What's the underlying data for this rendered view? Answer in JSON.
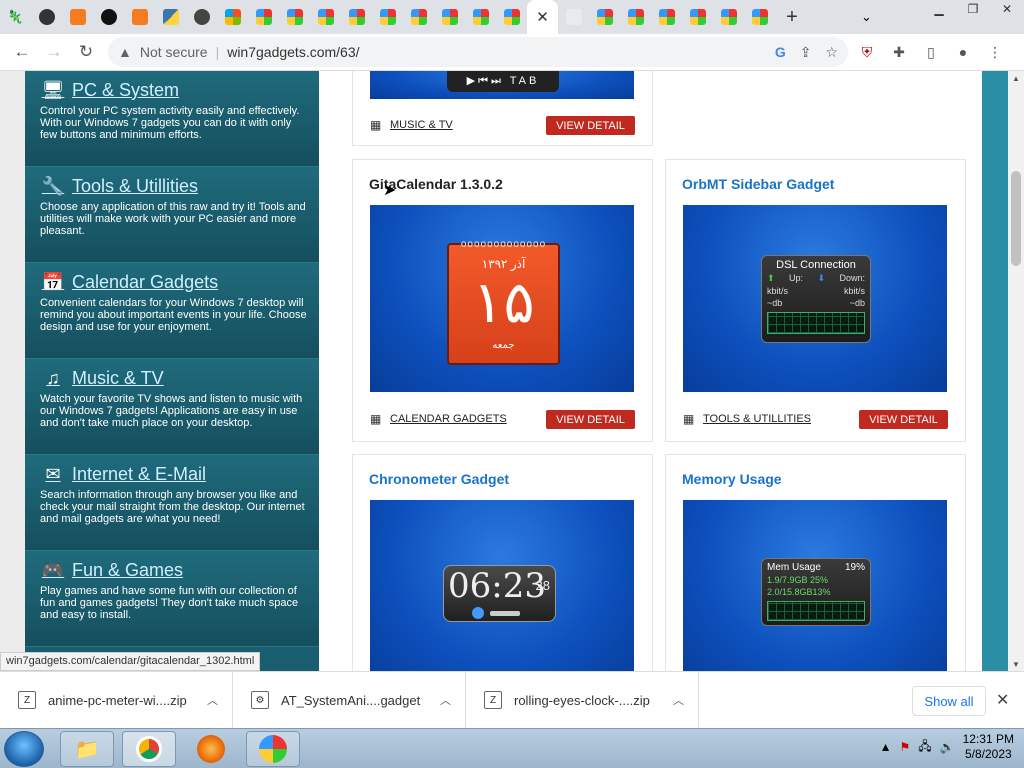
{
  "browser": {
    "tab_close": "✕",
    "new_tab": "+",
    "not_secure": "Not secure",
    "url": "win7gadgets.com/63/"
  },
  "sidebar": {
    "categories": [
      {
        "title": "PC & System",
        "icon": "monitor-icon",
        "desc": "Control your PC system activity easily and effectively. With our Windows 7 gadgets you can do it with only few buttons and minimum efforts."
      },
      {
        "title": "Tools & Utillities",
        "icon": "wrench-icon",
        "desc": "Choose any application of this raw and try it! Tools and utilities will make work with your PC easier and more pleasant."
      },
      {
        "title": "Calendar Gadgets",
        "icon": "calendar-icon",
        "desc": "Convenient calendars for your Windows 7 desktop will remind you about important events in your life. Choose design and use for your enjoyment."
      },
      {
        "title": "Music & TV",
        "icon": "music-note-icon",
        "desc": "Watch your favorite TV shows and listen to music with our Windows 7 gadgets! Applications are easy in use and don't take much place on your desktop."
      },
      {
        "title": "Internet & E-Mail",
        "icon": "envelope-icon",
        "desc": "Search information through any browser you like and check your mail straight from the desktop. Our internet and mail gadgets are what you need!"
      },
      {
        "title": "Fun & Games",
        "icon": "gamepad-icon",
        "desc": "Play games and have some fun with our collection of fun and games gadgets! They don't take much space and easy to install."
      }
    ]
  },
  "cards": {
    "top": {
      "category": "MUSIC & TV",
      "button": "VIEW DETAIL",
      "mediabar": "▶⏮⏭ TAB"
    },
    "gita": {
      "title": "GitaCalendar 1.3.0.2",
      "category": "CALENDAR GADGETS",
      "button": "VIEW DETAIL",
      "month": "آذر ۱۳۹۲",
      "day": "۱۵",
      "weekday": "جمعه"
    },
    "orbmt": {
      "title": "OrbMT Sidebar Gadget",
      "category": "TOOLS & UTILLITIES",
      "button": "VIEW DETAIL",
      "gadget_title": "DSL Connection",
      "up": "Up:",
      "down": "Down:",
      "unit1": "kbit/s",
      "unit2": "kbit/s",
      "db1": "~db",
      "db2": "~db"
    },
    "chrono": {
      "title": "Chronometer Gadget",
      "time": "06:23",
      "seconds": "28"
    },
    "memory": {
      "title": "Memory Usage",
      "gadget_title": "Mem Usage",
      "percent": "19%",
      "row1": "1.9/7.9GB 25%",
      "row2": "2.0/15.8GB13%"
    }
  },
  "status_url": "win7gadgets.com/calendar/gitacalendar_1302.html",
  "downloads": {
    "items": [
      {
        "name": "anime-pc-meter-wi....zip"
      },
      {
        "name": "AT_SystemAni....gadget"
      },
      {
        "name": "rolling-eyes-clock-....zip"
      }
    ],
    "show_all": "Show all"
  },
  "taskbar": {
    "time": "12:31 PM",
    "date": "5/8/2023"
  }
}
